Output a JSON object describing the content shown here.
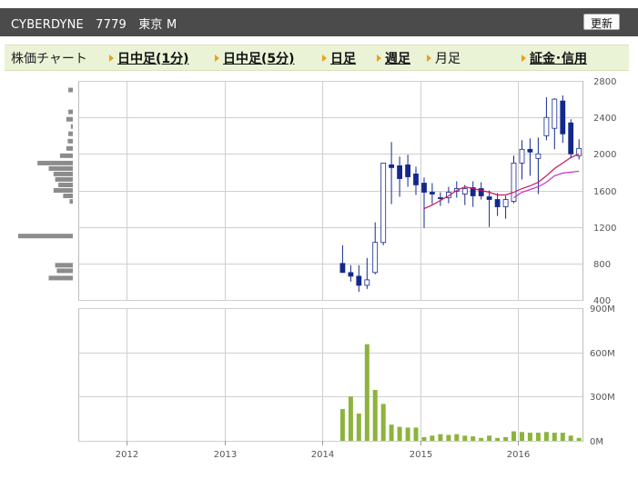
{
  "header": {
    "title": "CYBERDYNE　7779　東京 M",
    "refresh_label": "更新"
  },
  "tabs": {
    "label": "株価チャート",
    "items": [
      {
        "label": "日中足(1分)",
        "link": true
      },
      {
        "label": "日中足(5分)",
        "link": true
      },
      {
        "label": "日足",
        "link": true
      },
      {
        "label": "週足",
        "link": true
      },
      {
        "label": "月足",
        "link": false
      },
      {
        "label": "証金･信用",
        "link": true
      }
    ]
  },
  "chart_data": {
    "type": "candlestick",
    "colors": {
      "up": "#ffffff",
      "down": "#14288c",
      "ma_short": "#c8145a",
      "ma_long": "#c832c8",
      "volume": "#8cb43c",
      "volume_profile": "#8c8c8c",
      "grid": "#cfcfcf"
    },
    "price_axis": {
      "min": 400,
      "max": 2800,
      "ticks": [
        "400",
        "800",
        "1200",
        "1600",
        "2000",
        "2400",
        "2800"
      ]
    },
    "volume_axis": {
      "min": 0,
      "max": 900,
      "ticks": [
        "0M",
        "300M",
        "600M",
        "900M"
      ]
    },
    "x_labels": [
      "2012",
      "2013",
      "2014",
      "2015",
      "2016"
    ],
    "candles": [
      {
        "date": "2014-03",
        "open": 800,
        "high": 1000,
        "low": 720,
        "close": 700
      },
      {
        "date": "2014-04",
        "open": 700,
        "high": 780,
        "low": 600,
        "close": 660
      },
      {
        "date": "2014-05",
        "open": 660,
        "high": 780,
        "low": 490,
        "close": 560
      },
      {
        "date": "2014-06",
        "open": 560,
        "high": 860,
        "low": 520,
        "close": 620
      },
      {
        "date": "2014-07",
        "open": 700,
        "high": 1250,
        "low": 680,
        "close": 1030
      },
      {
        "date": "2014-08",
        "open": 1030,
        "high": 1900,
        "low": 1000,
        "close": 1900
      },
      {
        "date": "2014-09",
        "open": 1880,
        "high": 2130,
        "low": 1450,
        "close": 1850
      },
      {
        "date": "2014-10",
        "open": 1870,
        "high": 1970,
        "low": 1530,
        "close": 1730
      },
      {
        "date": "2014-11",
        "open": 1880,
        "high": 1990,
        "low": 1640,
        "close": 1750
      },
      {
        "date": "2014-12",
        "open": 1780,
        "high": 1860,
        "low": 1550,
        "close": 1660
      },
      {
        "date": "2015-01",
        "open": 1680,
        "high": 1740,
        "low": 1190,
        "close": 1580
      },
      {
        "date": "2015-02",
        "open": 1580,
        "high": 1680,
        "low": 1450,
        "close": 1560
      },
      {
        "date": "2015-03",
        "open": 1520,
        "high": 1580,
        "low": 1430,
        "close": 1510
      },
      {
        "date": "2015-04",
        "open": 1520,
        "high": 1640,
        "low": 1460,
        "close": 1580
      },
      {
        "date": "2015-05",
        "open": 1590,
        "high": 1700,
        "low": 1520,
        "close": 1620
      },
      {
        "date": "2015-06",
        "open": 1560,
        "high": 1660,
        "low": 1440,
        "close": 1620
      },
      {
        "date": "2015-07",
        "open": 1630,
        "high": 1700,
        "low": 1420,
        "close": 1540
      },
      {
        "date": "2015-08",
        "open": 1620,
        "high": 1690,
        "low": 1500,
        "close": 1540
      },
      {
        "date": "2015-09",
        "open": 1530,
        "high": 1600,
        "low": 1200,
        "close": 1500
      },
      {
        "date": "2015-10",
        "open": 1500,
        "high": 1570,
        "low": 1320,
        "close": 1420
      },
      {
        "date": "2015-11",
        "open": 1420,
        "high": 1540,
        "low": 1290,
        "close": 1500
      },
      {
        "date": "2015-12",
        "open": 1480,
        "high": 1980,
        "low": 1460,
        "close": 1900
      },
      {
        "date": "2016-01",
        "open": 1900,
        "high": 2150,
        "low": 1720,
        "close": 2050
      },
      {
        "date": "2016-02",
        "open": 2050,
        "high": 2170,
        "low": 1760,
        "close": 2020
      },
      {
        "date": "2016-03",
        "open": 1950,
        "high": 2180,
        "low": 1560,
        "close": 2000
      },
      {
        "date": "2016-04",
        "open": 2200,
        "high": 2620,
        "low": 2150,
        "close": 2400
      },
      {
        "date": "2016-05",
        "open": 2280,
        "high": 2610,
        "low": 2050,
        "close": 2600
      },
      {
        "date": "2016-06",
        "open": 2580,
        "high": 2640,
        "low": 2120,
        "close": 2220
      },
      {
        "date": "2016-07",
        "open": 2340,
        "high": 2380,
        "low": 1950,
        "close": 2000
      },
      {
        "date": "2016-08",
        "open": 1980,
        "high": 2160,
        "low": 1940,
        "close": 2060
      }
    ],
    "ma_short": [
      {
        "date": "2015-01",
        "value": 1400
      },
      {
        "date": "2015-02",
        "value": 1440
      },
      {
        "date": "2015-03",
        "value": 1490
      },
      {
        "date": "2015-04",
        "value": 1540
      },
      {
        "date": "2015-05",
        "value": 1600
      },
      {
        "date": "2015-06",
        "value": 1640
      },
      {
        "date": "2015-07",
        "value": 1620
      },
      {
        "date": "2015-08",
        "value": 1600
      },
      {
        "date": "2015-09",
        "value": 1580
      },
      {
        "date": "2015-10",
        "value": 1550
      },
      {
        "date": "2015-11",
        "value": 1550
      },
      {
        "date": "2015-12",
        "value": 1580
      },
      {
        "date": "2016-01",
        "value": 1620
      },
      {
        "date": "2016-02",
        "value": 1650
      },
      {
        "date": "2016-03",
        "value": 1690
      },
      {
        "date": "2016-04",
        "value": 1760
      },
      {
        "date": "2016-05",
        "value": 1840
      },
      {
        "date": "2016-06",
        "value": 1900
      },
      {
        "date": "2016-07",
        "value": 1960
      },
      {
        "date": "2016-08",
        "value": 2000
      }
    ],
    "ma_long": [
      {
        "date": "2015-12",
        "value": 1520
      },
      {
        "date": "2016-01",
        "value": 1580
      },
      {
        "date": "2016-02",
        "value": 1610
      },
      {
        "date": "2016-03",
        "value": 1640
      },
      {
        "date": "2016-04",
        "value": 1690
      },
      {
        "date": "2016-05",
        "value": 1760
      },
      {
        "date": "2016-06",
        "value": 1790
      },
      {
        "date": "2016-07",
        "value": 1800
      },
      {
        "date": "2016-08",
        "value": 1810
      }
    ],
    "volume": [
      {
        "date": "2014-03",
        "value": 215
      },
      {
        "date": "2014-04",
        "value": 300
      },
      {
        "date": "2014-05",
        "value": 185
      },
      {
        "date": "2014-06",
        "value": 655
      },
      {
        "date": "2014-07",
        "value": 345
      },
      {
        "date": "2014-08",
        "value": 250
      },
      {
        "date": "2014-09",
        "value": 110
      },
      {
        "date": "2014-10",
        "value": 95
      },
      {
        "date": "2014-11",
        "value": 90
      },
      {
        "date": "2014-12",
        "value": 90
      },
      {
        "date": "2015-01",
        "value": 25
      },
      {
        "date": "2015-02",
        "value": 35
      },
      {
        "date": "2015-03",
        "value": 45
      },
      {
        "date": "2015-04",
        "value": 40
      },
      {
        "date": "2015-05",
        "value": 45
      },
      {
        "date": "2015-06",
        "value": 35
      },
      {
        "date": "2015-07",
        "value": 30
      },
      {
        "date": "2015-08",
        "value": 20
      },
      {
        "date": "2015-09",
        "value": 35
      },
      {
        "date": "2015-10",
        "value": 20
      },
      {
        "date": "2015-11",
        "value": 25
      },
      {
        "date": "2015-12",
        "value": 65
      },
      {
        "date": "2016-01",
        "value": 60
      },
      {
        "date": "2016-02",
        "value": 55
      },
      {
        "date": "2016-03",
        "value": 55
      },
      {
        "date": "2016-04",
        "value": 60
      },
      {
        "date": "2016-05",
        "value": 55
      },
      {
        "date": "2016-06",
        "value": 55
      },
      {
        "date": "2016-07",
        "value": 35
      },
      {
        "date": "2016-08",
        "value": 20
      }
    ],
    "volume_profile": [
      {
        "price": 2700,
        "value": 14
      },
      {
        "price": 2460,
        "value": 14
      },
      {
        "price": 2380,
        "value": 20
      },
      {
        "price": 2300,
        "value": 6
      },
      {
        "price": 2220,
        "value": 14
      },
      {
        "price": 2140,
        "value": 16
      },
      {
        "price": 2060,
        "value": 20
      },
      {
        "price": 1980,
        "value": 40
      },
      {
        "price": 1900,
        "value": 110
      },
      {
        "price": 1840,
        "value": 75
      },
      {
        "price": 1780,
        "value": 60
      },
      {
        "price": 1720,
        "value": 55
      },
      {
        "price": 1660,
        "value": 45
      },
      {
        "price": 1600,
        "value": 60
      },
      {
        "price": 1540,
        "value": 30
      },
      {
        "price": 1480,
        "value": 10
      },
      {
        "price": 1100,
        "value": 170
      },
      {
        "price": 780,
        "value": 55
      },
      {
        "price": 720,
        "value": 50
      },
      {
        "price": 640,
        "value": 75
      }
    ]
  }
}
